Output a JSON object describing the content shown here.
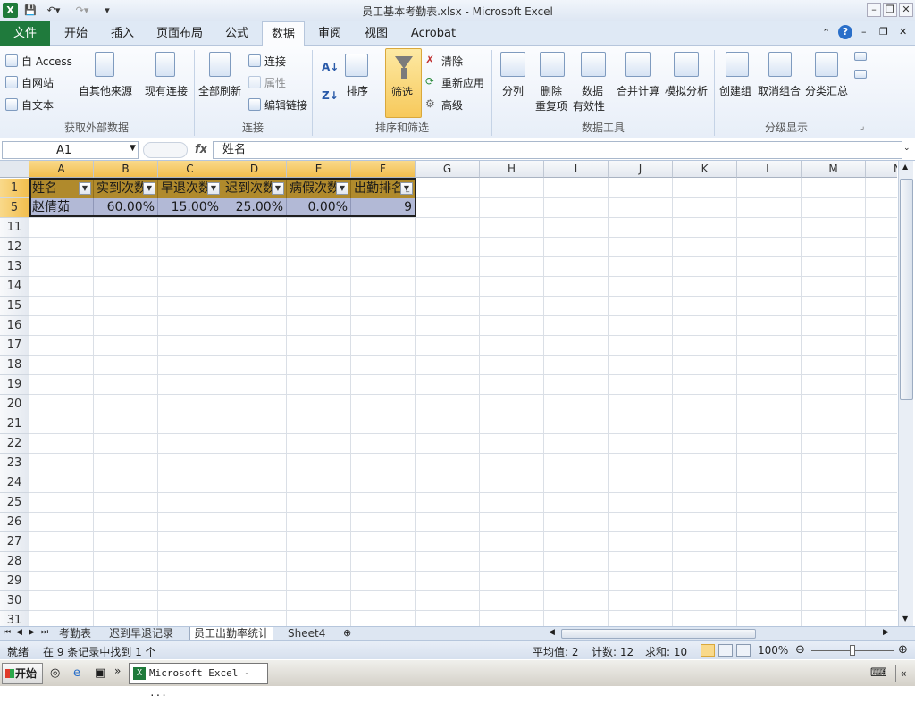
{
  "window": {
    "title": "员工基本考勤表.xlsx - Microsoft Excel",
    "app_icon": "X"
  },
  "tabs": [
    "文件",
    "开始",
    "插入",
    "页面布局",
    "公式",
    "数据",
    "审阅",
    "视图",
    "Acrobat"
  ],
  "active_tab": "数据",
  "ribbon": {
    "get_external": {
      "access": "自 Access",
      "web": "自网站",
      "text": "自文本",
      "other": "自其他来源",
      "existing": "现有连接",
      "label": "获取外部数据"
    },
    "connections": {
      "refresh_all": "全部刷新",
      "connections": "连接",
      "properties": "属性",
      "edit_links": "编辑链接",
      "label": "连接"
    },
    "sort_filter": {
      "sort": "排序",
      "filter": "筛选",
      "clear": "清除",
      "reapply": "重新应用",
      "advanced": "高级",
      "label": "排序和筛选"
    },
    "data_tools": {
      "text_to_columns": "分列",
      "remove_dup_1": "删除",
      "remove_dup_2": "重复项",
      "validation_1": "数据",
      "validation_2": "有效性",
      "consolidate": "合并计算",
      "what_if": "模拟分析",
      "label": "数据工具"
    },
    "outline": {
      "group": "创建组",
      "ungroup": "取消组合",
      "subtotal": "分类汇总",
      "label": "分级显示"
    }
  },
  "formula_bar": {
    "name_box": "A1",
    "fx": "fx",
    "formula": "姓名"
  },
  "sheet": {
    "columns": [
      "A",
      "B",
      "C",
      "D",
      "E",
      "F",
      "G",
      "H",
      "I",
      "J",
      "K",
      "L",
      "M",
      "N"
    ],
    "row_numbers": [
      "1",
      "5",
      "11",
      "12",
      "13",
      "14",
      "15",
      "16",
      "17",
      "18",
      "19",
      "20",
      "21",
      "22",
      "23",
      "24",
      "25",
      "26",
      "27",
      "28",
      "29",
      "30",
      "31"
    ],
    "headers": [
      "姓名",
      "实到次数",
      "早退次数",
      "迟到次数",
      "病假次数",
      "出勤排名"
    ],
    "row": [
      "赵倩茹",
      "60.00%",
      "15.00%",
      "25.00%",
      "0.00%",
      "9"
    ]
  },
  "sheet_tabs": [
    "考勤表",
    "迟到早退记录",
    "员工出勤率统计",
    "Sheet4"
  ],
  "active_sheet": "员工出勤率统计",
  "status": {
    "ready": "就绪",
    "filter_msg": "在 9 条记录中找到 1 个",
    "average": "平均值: 2",
    "count": "计数: 12",
    "sum": "求和: 10",
    "zoom": "100%"
  },
  "taskbar": {
    "start": "开始",
    "excel_task": "Microsoft Excel - ..."
  },
  "colors": {
    "header_fill": "#b08a2c",
    "row_fill": "#b2b9d6",
    "file_tab": "#1f7a3c",
    "filter_active": "#f7c95b"
  }
}
